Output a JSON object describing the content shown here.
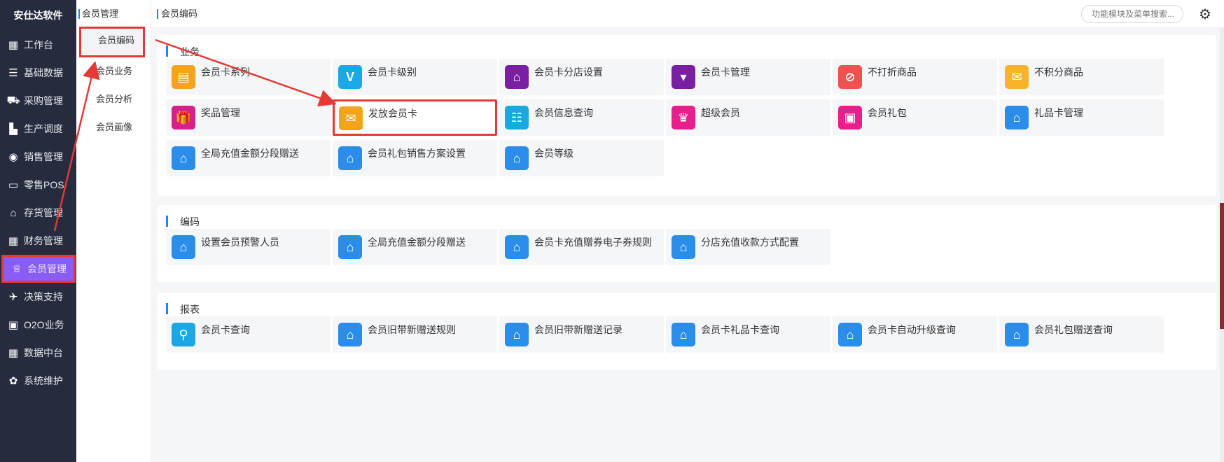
{
  "app": {
    "logo_text": "安仕达软件"
  },
  "nav": {
    "items": [
      {
        "label": "工作台",
        "icon": "grid-icon",
        "glyph": "▦"
      },
      {
        "label": "基础数据",
        "icon": "database-icon",
        "glyph": "☰"
      },
      {
        "label": "采购管理",
        "icon": "cart-icon",
        "glyph": "⛟"
      },
      {
        "label": "生产调度",
        "icon": "factory-icon",
        "glyph": "▙"
      },
      {
        "label": "销售管理",
        "icon": "sales-icon",
        "glyph": "◉"
      },
      {
        "label": "零售POS",
        "icon": "store-icon",
        "glyph": "▭"
      },
      {
        "label": "存货管理",
        "icon": "warehouse-icon",
        "glyph": "⌂"
      },
      {
        "label": "财务管理",
        "icon": "finance-grid-icon",
        "glyph": "▦"
      },
      {
        "label": "会员管理",
        "icon": "crown-icon",
        "glyph": "♕"
      },
      {
        "label": "决策支持",
        "icon": "chart-icon",
        "glyph": "✈"
      },
      {
        "label": "O2O业务",
        "icon": "monitor-icon",
        "glyph": "▣"
      },
      {
        "label": "数据中台",
        "icon": "data-grid-icon",
        "glyph": "▦"
      },
      {
        "label": "系统维护",
        "icon": "settings-icon",
        "glyph": "✿"
      }
    ],
    "active_index": 8
  },
  "submenu": {
    "title": "会员管理",
    "items": [
      "会员编码",
      "会员业务",
      "会员分析",
      "会员画像"
    ],
    "active_index": 0
  },
  "topbar": {
    "breadcrumb": "会员编码",
    "search_placeholder": "功能模块及菜单搜索..."
  },
  "sections": [
    {
      "title": "业务",
      "tiles": [
        {
          "label": "会员卡系列",
          "icon": "card-stack-icon",
          "color": "#f5a31a",
          "glyph": "▤"
        },
        {
          "label": "会员卡级别",
          "icon": "v-level-icon",
          "color": "#1aa8e6",
          "glyph": "V"
        },
        {
          "label": "会员卡分店设置",
          "icon": "store-home-icon",
          "color": "#7b1fa2",
          "glyph": "⌂"
        },
        {
          "label": "会员卡管理",
          "icon": "card-manage-icon",
          "color": "#7b1fa2",
          "glyph": "▾"
        },
        {
          "label": "不打折商品",
          "icon": "no-discount-icon",
          "color": "#ef5350",
          "glyph": "⊘"
        },
        {
          "label": "不积分商品",
          "icon": "no-points-icon",
          "color": "#f9b32b",
          "glyph": "✉"
        },
        {
          "label": "奖品管理",
          "icon": "gift-box-icon",
          "color": "#d6218b",
          "glyph": "🎁"
        },
        {
          "label": "发放会员卡",
          "icon": "issue-card-icon",
          "color": "#f5a31a",
          "glyph": "✉"
        },
        {
          "label": "会员信息查询",
          "icon": "info-search-icon",
          "color": "#18a9e0",
          "glyph": "☷"
        },
        {
          "label": "超级会员",
          "icon": "super-crown-icon",
          "color": "#e91e8c",
          "glyph": "♛"
        },
        {
          "label": "会员礼包",
          "icon": "gift-pack-icon",
          "color": "#e91e8c",
          "glyph": "▣"
        },
        {
          "label": "礼品卡管理",
          "icon": "home-icon",
          "color": "#2a8dea",
          "glyph": "⌂"
        },
        {
          "label": "全局充值金额分段赠送",
          "icon": "home-icon",
          "color": "#2a8dea",
          "glyph": "⌂"
        },
        {
          "label": "会员礼包销售方案设置",
          "icon": "home-icon",
          "color": "#2a8dea",
          "glyph": "⌂"
        },
        {
          "label": "会员等级",
          "icon": "home-icon",
          "color": "#2a8dea",
          "glyph": "⌂"
        }
      ]
    },
    {
      "title": "编码",
      "tiles": [
        {
          "label": "设置会员预警人员",
          "icon": "home-icon",
          "color": "#2a8dea",
          "glyph": "⌂"
        },
        {
          "label": "全局充值金额分段赠送",
          "icon": "home-icon",
          "color": "#2a8dea",
          "glyph": "⌂"
        },
        {
          "label": "会员卡充值赠券电子券规则",
          "icon": "home-icon",
          "color": "#2a8dea",
          "glyph": "⌂"
        },
        {
          "label": "分店充值收款方式配置",
          "icon": "home-icon",
          "color": "#2a8dea",
          "glyph": "⌂"
        }
      ]
    },
    {
      "title": "报表",
      "tiles": [
        {
          "label": "会员卡查询",
          "icon": "magnifier-icon",
          "color": "#1aa8e6",
          "glyph": "⚲"
        },
        {
          "label": "会员旧带新赠送规则",
          "icon": "home-icon",
          "color": "#2a8dea",
          "glyph": "⌂"
        },
        {
          "label": "会员旧带新赠送记录",
          "icon": "home-icon",
          "color": "#2a8dea",
          "glyph": "⌂"
        },
        {
          "label": "会员卡礼品卡查询",
          "icon": "home-icon",
          "color": "#2a8dea",
          "glyph": "⌂"
        },
        {
          "label": "会员卡自动升级查询",
          "icon": "home-icon",
          "color": "#2a8dea",
          "glyph": "⌂"
        },
        {
          "label": "会员礼包赠送查询",
          "icon": "home-icon",
          "color": "#2a8dea",
          "glyph": "⌂"
        }
      ]
    }
  ],
  "highlight_tile": "发放会员卡"
}
